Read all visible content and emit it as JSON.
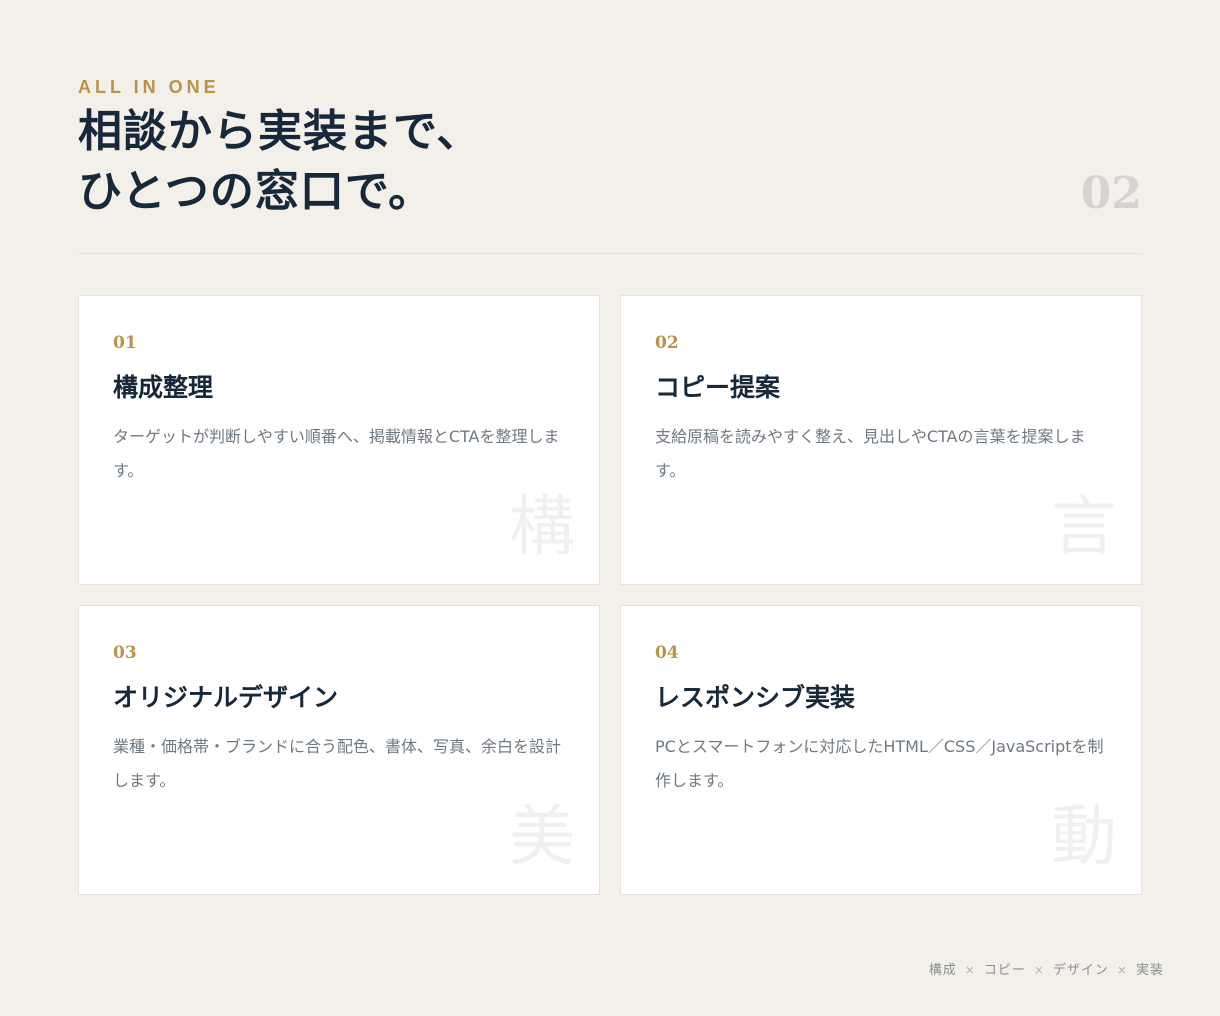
{
  "header": {
    "eyebrow": "ALL IN ONE",
    "title_lines": [
      "相談から実装まで、",
      "ひとつの窓口で。"
    ],
    "section_number": "02"
  },
  "cards": [
    {
      "number": "01",
      "title": "構成整理",
      "description": "ターゲットが判断しやすい順番へ、掲載情報とCTAを整理します。",
      "kanji": "構"
    },
    {
      "number": "02",
      "title": "コピー提案",
      "description": "支給原稿を読みやすく整え、見出しやCTAの言葉を提案します。",
      "kanji": "言"
    },
    {
      "number": "03",
      "title": "オリジナルデザイン",
      "description": "業種・価格帯・ブランドに合う配色、書体、写真、余白を設計します。",
      "kanji": "美"
    },
    {
      "number": "04",
      "title": "レスポンシブ実装",
      "description": "PCとスマートフォンに対応したHTML／CSS／JavaScriptを制作します。",
      "kanji": "動"
    }
  ],
  "footer": {
    "items": [
      "構成",
      "コピー",
      "デザイン",
      "実装"
    ],
    "separator": "×"
  },
  "colors": {
    "background": "#f3f0e9",
    "accent_gold": "#b8944a",
    "heading_navy": "#17283a",
    "body_gray": "#6f7982",
    "card_bg": "#ffffff"
  }
}
